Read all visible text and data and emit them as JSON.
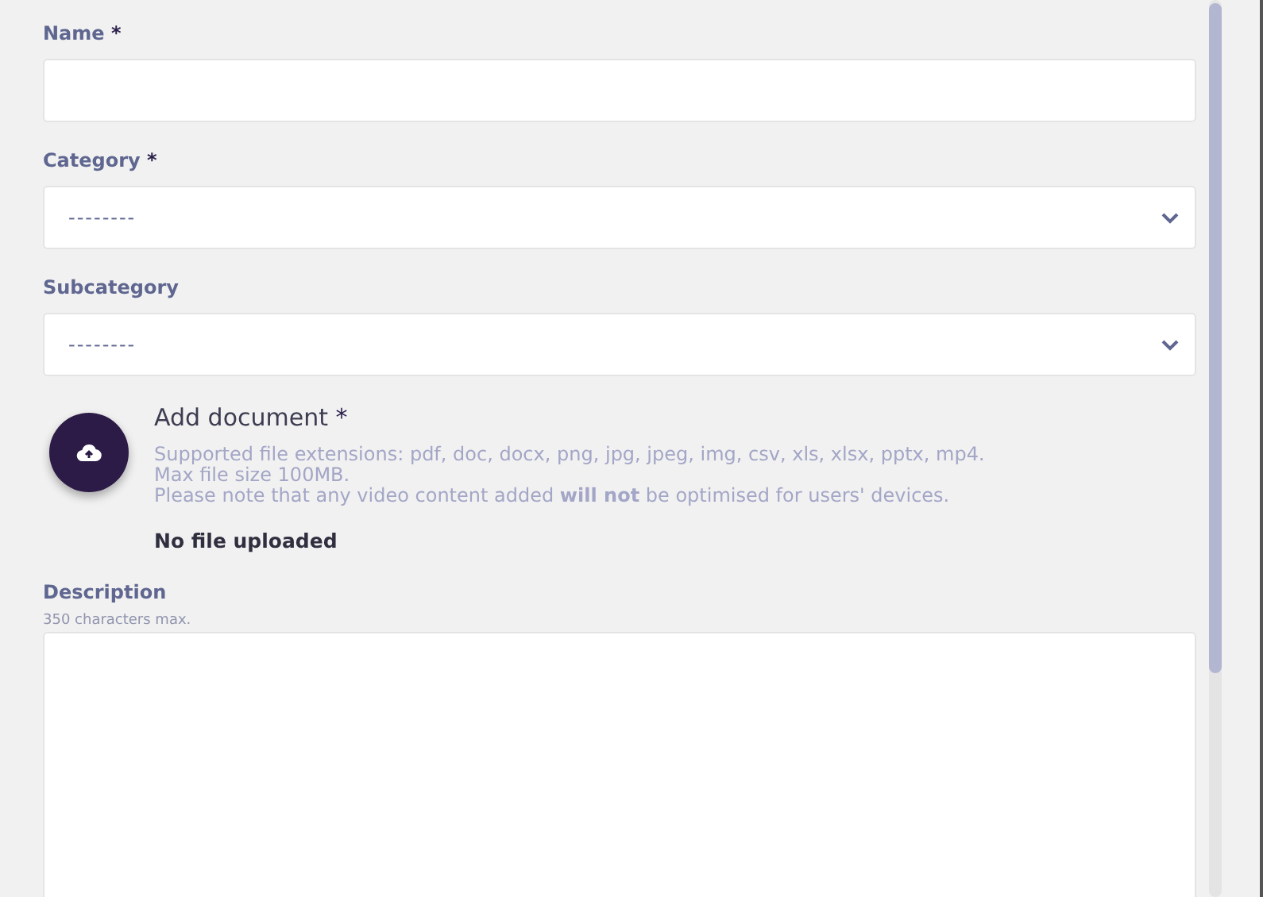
{
  "fields": [
    {
      "kind": "text",
      "label": "Name",
      "required_mark": "*"
    },
    {
      "kind": "select",
      "label": "Category",
      "required_mark": "*",
      "value": "--------"
    },
    {
      "kind": "select",
      "label": "Subcategory",
      "value": "--------"
    }
  ],
  "upload": {
    "title": "Add document",
    "required_mark": "*",
    "info": [
      "Supported file extensions: pdf, doc, docx, png, jpg, jpeg, img, csv, xls, xlsx, pptx, mp4.",
      "Max file size 100MB.",
      "Please note that any video content added **will not** be optimised for users' devices."
    ],
    "status": "No file uploaded"
  },
  "description": {
    "label": "Description",
    "hint": "350 characters max."
  }
}
